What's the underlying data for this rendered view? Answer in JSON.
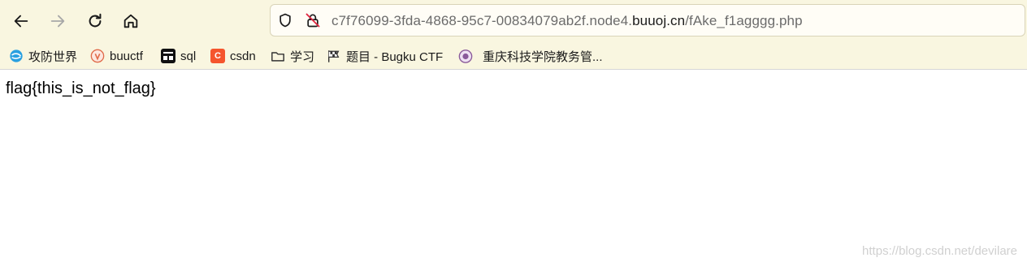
{
  "browser": {
    "url_prefix": "c7f76099-3fda-4868-95c7-00834079ab2f.node4.",
    "url_domain": "buuoj.cn",
    "url_path": "/fAke_f1agggg.php"
  },
  "bookmarks": [
    {
      "label": "攻防世界",
      "icon": "globe-swirl-icon",
      "color": "#2aa0e0"
    },
    {
      "label": "buuctf",
      "icon": "buuctf-logo-icon",
      "color": "#e06b4a"
    },
    {
      "label": "sql",
      "icon": "hack-it-icon",
      "color": "#111111"
    },
    {
      "label": "csdn",
      "icon": "csdn-c-icon",
      "color": "#f5552d",
      "glyph": "C"
    },
    {
      "label": "学习",
      "icon": "folder-icon",
      "color": "#333333"
    },
    {
      "label": "题目 - Bugku CTF",
      "icon": "checkered-flag-icon",
      "color": "#333333"
    },
    {
      "label": "重庆科技学院教务管...",
      "icon": "university-seal-icon",
      "color": "#8a5a9a"
    }
  ],
  "page": {
    "text": "flag{this_is_not_flag}"
  },
  "watermark": "https://blog.csdn.net/devilare"
}
